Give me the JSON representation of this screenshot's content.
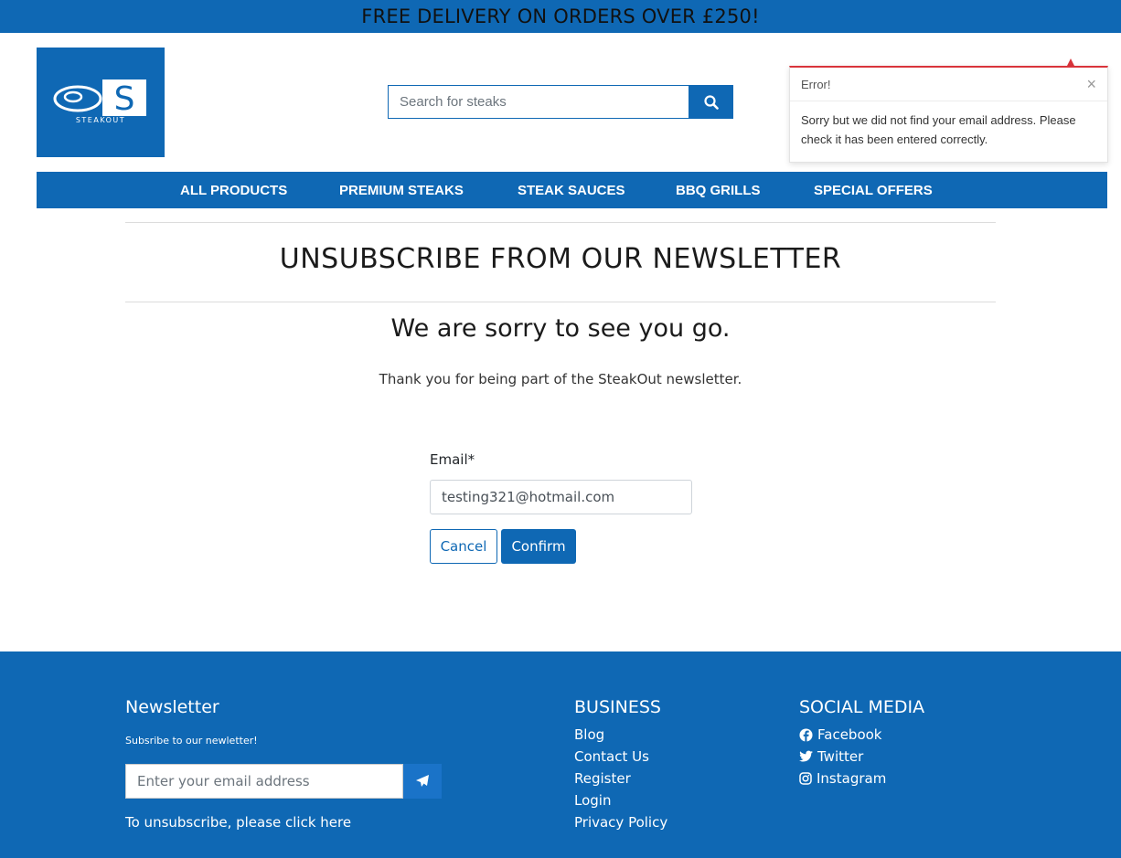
{
  "promo": {
    "text": "FREE DELIVERY ON ORDERS OVER £250!"
  },
  "logo": {
    "icon": "steakout-logo",
    "brand": "STEAKOUT",
    "letter": "S"
  },
  "search": {
    "placeholder": "Search for steaks",
    "icon": "search-icon"
  },
  "toast": {
    "title": "Error!",
    "message": "Sorry but we did not find your email address. Please check it has been entered correctly.",
    "close": "×",
    "accent": "#d9343b"
  },
  "nav": {
    "items": [
      {
        "label": "ALL PRODUCTS"
      },
      {
        "label": "PREMIUM STEAKS"
      },
      {
        "label": "STEAK SAUCES"
      },
      {
        "label": "BBQ GRILLS"
      },
      {
        "label": "SPECIAL OFFERS"
      }
    ]
  },
  "main": {
    "title": "UNSUBSCRIBE FROM OUR NEWSLETTER",
    "sorry": "We are sorry to see you go.",
    "thanks": "Thank you for being part of the SteakOut newsletter.",
    "email_label": "Email*",
    "email_value": "testing321@hotmail.com",
    "cancel_label": "Cancel",
    "confirm_label": "Confirm"
  },
  "footer": {
    "newsletter": {
      "heading": "Newsletter",
      "subtitle": "Subsribe to our newletter!",
      "placeholder": "Enter your email address",
      "send_icon": "paper-plane-icon",
      "unsubscribe": "To unsubscribe, please click here"
    },
    "business": {
      "heading": "BUSINESS",
      "links": [
        "Blog",
        "Contact Us",
        "Register",
        "Login",
        "Privacy Policy"
      ]
    },
    "social": {
      "heading": "SOCIAL MEDIA",
      "links": [
        {
          "label": "Facebook",
          "icon": "facebook-icon"
        },
        {
          "label": "Twitter",
          "icon": "twitter-icon"
        },
        {
          "label": "Instagram",
          "icon": "instagram-icon"
        }
      ]
    }
  },
  "colors": {
    "brand": "#0f68b4",
    "error": "#d9343b"
  }
}
